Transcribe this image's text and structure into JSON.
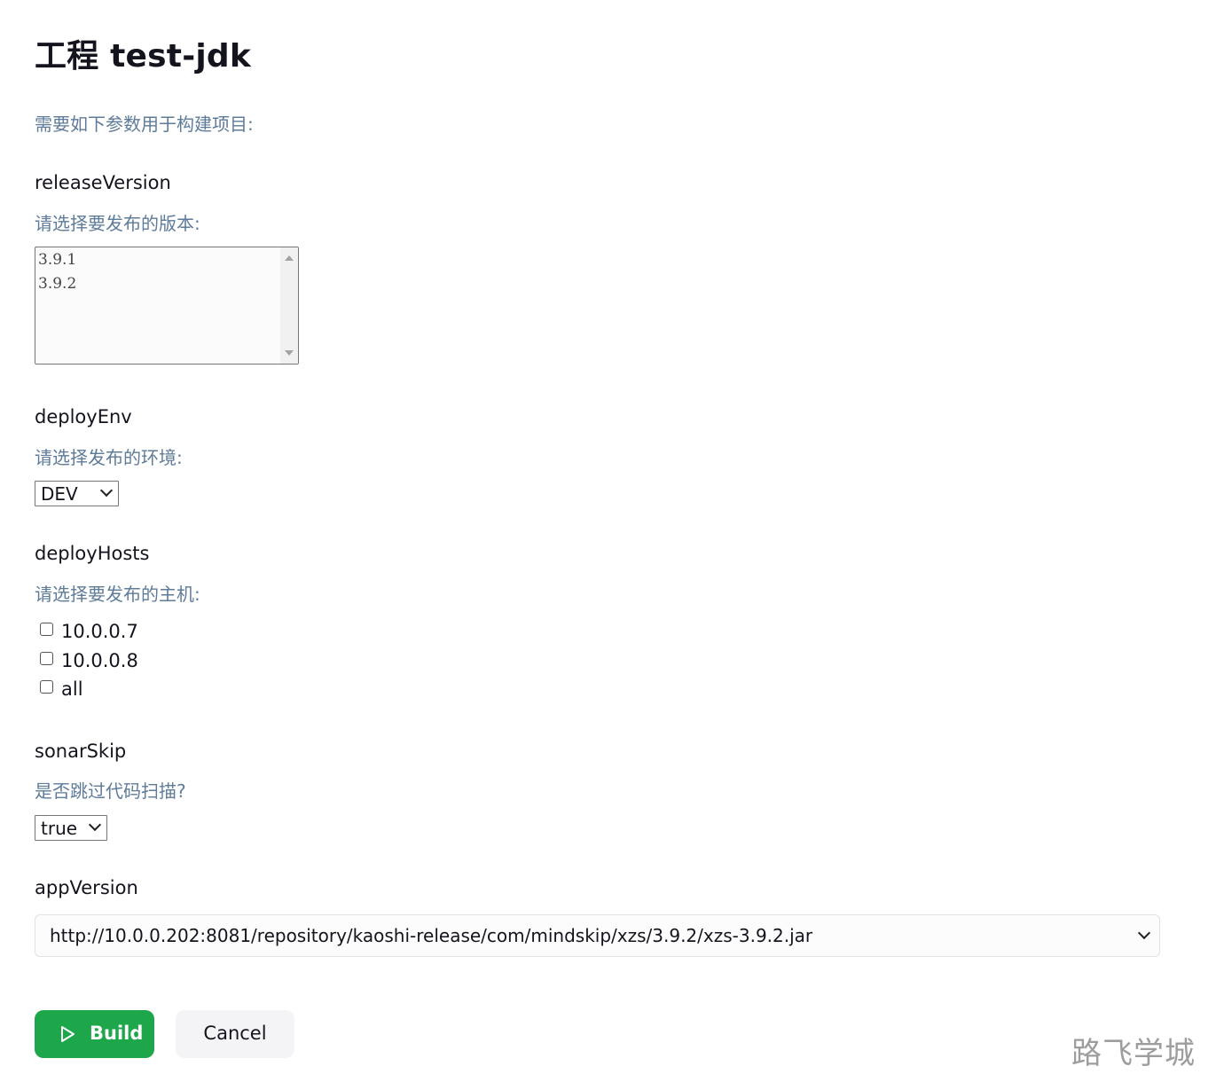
{
  "page": {
    "title": "工程 test-jdk",
    "intro": "需要如下参数用于构建项目:"
  },
  "params": {
    "releaseVersion": {
      "name": "releaseVersion",
      "description": "请选择要发布的版本:",
      "options": [
        "3.9.1",
        "3.9.2"
      ]
    },
    "deployEnv": {
      "name": "deployEnv",
      "description": "请选择发布的环境:",
      "selected": "DEV"
    },
    "deployHosts": {
      "name": "deployHosts",
      "description": "请选择要发布的主机:",
      "options": [
        {
          "label": "10.0.0.7",
          "checked": false
        },
        {
          "label": "10.0.0.8",
          "checked": false
        },
        {
          "label": "all",
          "checked": false
        }
      ]
    },
    "sonarSkip": {
      "name": "sonarSkip",
      "description": "是否跳过代码扫描?",
      "selected": "true"
    },
    "appVersion": {
      "name": "appVersion",
      "selected": "http://10.0.0.202:8081/repository/kaoshi-release/com/mindskip/xzs/3.9.2/xzs-3.9.2.jar"
    }
  },
  "actions": {
    "build_label": "Build",
    "cancel_label": "Cancel",
    "build_color": "#1ea64a"
  },
  "watermark": "路飞学城"
}
